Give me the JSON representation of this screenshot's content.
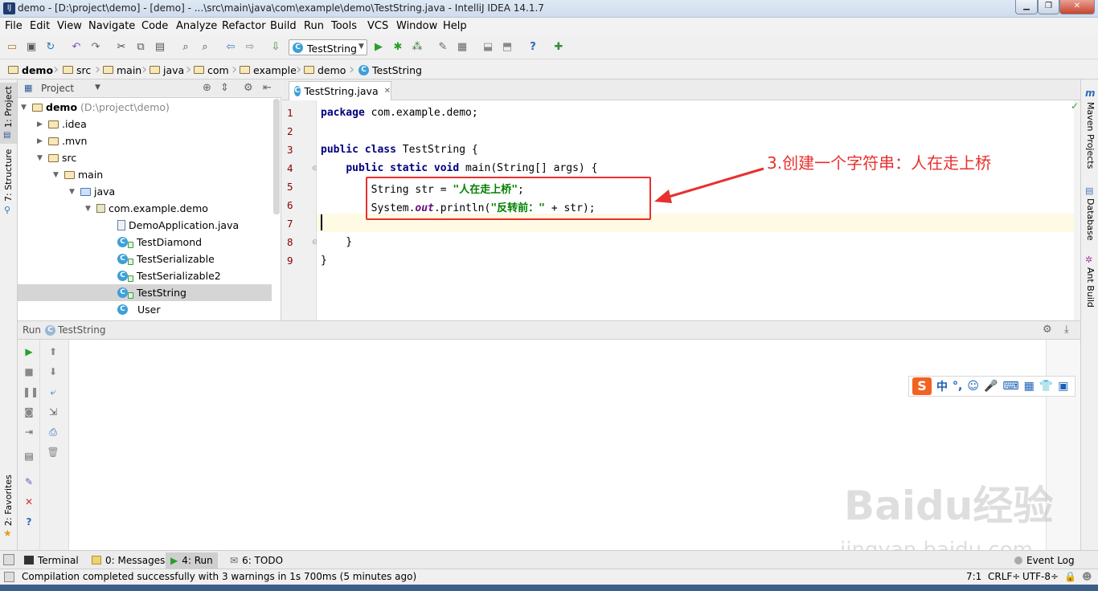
{
  "window": {
    "title": "demo - [D:\\project\\demo] - [demo] - ...\\src\\main\\java\\com\\example\\demo\\TestString.java - IntelliJ IDEA 14.1.7",
    "app_icon_text": "IJ"
  },
  "menu": [
    "File",
    "Edit",
    "View",
    "Navigate",
    "Code",
    "Analyze",
    "Refactor",
    "Build",
    "Run",
    "Tools",
    "VCS",
    "Window",
    "Help"
  ],
  "toolbar": {
    "run_config": "TestString"
  },
  "breadcrumb": [
    "demo",
    "src",
    "main",
    "java",
    "com",
    "example",
    "demo",
    "TestString"
  ],
  "left_strip": {
    "project_tab": "1: Project",
    "structure_tab": "7: Structure",
    "favorites_tab": "2: Favorites"
  },
  "right_strip": {
    "maven": "Maven Projects",
    "database": "Database",
    "ant": "Ant Build"
  },
  "project_panel": {
    "header": "Project",
    "tree": [
      {
        "label": "demo",
        "extra": "(D:\\project\\demo)",
        "kind": "module"
      },
      {
        "label": ".idea",
        "kind": "folder"
      },
      {
        "label": ".mvn",
        "kind": "folder"
      },
      {
        "label": "src",
        "kind": "folder"
      },
      {
        "label": "main",
        "kind": "folder"
      },
      {
        "label": "java",
        "kind": "folder"
      },
      {
        "label": "com.example.demo",
        "kind": "package"
      },
      {
        "label": "DemoApplication.java",
        "kind": "java-file"
      },
      {
        "label": "TestDiamond",
        "kind": "class"
      },
      {
        "label": "TestSerializable",
        "kind": "class"
      },
      {
        "label": "TestSerializable2",
        "kind": "class"
      },
      {
        "label": "TestString",
        "kind": "class",
        "selected": true
      },
      {
        "label": "User",
        "kind": "class"
      }
    ]
  },
  "editor": {
    "tab_label": "TestString.java",
    "line_numbers": [
      "1",
      "2",
      "3",
      "4",
      "5",
      "6",
      "7",
      "8",
      "9"
    ],
    "code": {
      "l1_kw": "package",
      "l1_rest": " com.example.demo;",
      "l3_kw": "public class",
      "l3_rest": " TestString {",
      "l4_indent": "    ",
      "l4_kw": "public static void",
      "l4_rest": " main(String[] args) {",
      "l5_pre": "        String str = ",
      "l5_str": "\"人在走上桥\"",
      "l5_post": ";",
      "l6_pre": "        System.",
      "l6_fld": "out",
      "l6_mid": ".println(",
      "l6_str": "\"反转前：\"",
      "l6_post": " + str);",
      "l8": "    }",
      "l9": "}"
    },
    "annotation": "3.创建一个字符串：人在走上桥"
  },
  "run_panel": {
    "label": "Run",
    "config": "TestString"
  },
  "ime": {
    "logo": "S",
    "text": "中",
    "punct": "°,"
  },
  "watermark": {
    "brand": "Baidu经验",
    "url": "jingyan.baidu.com"
  },
  "bottom_tabs": [
    {
      "label": "Terminal"
    },
    {
      "label": "0: Messages"
    },
    {
      "label": "4: Run"
    },
    {
      "label": "6: TODO"
    }
  ],
  "event_log": "Event Log",
  "status": {
    "message": "Compilation completed successfully with 3 warnings in 1s 700ms (5 minutes ago)",
    "position": "7:1",
    "line_sep": "CRLF÷",
    "encoding": "UTF-8÷"
  },
  "colors": {
    "annotation": "#e8302e",
    "keyword": "#000080",
    "string": "#008000"
  }
}
